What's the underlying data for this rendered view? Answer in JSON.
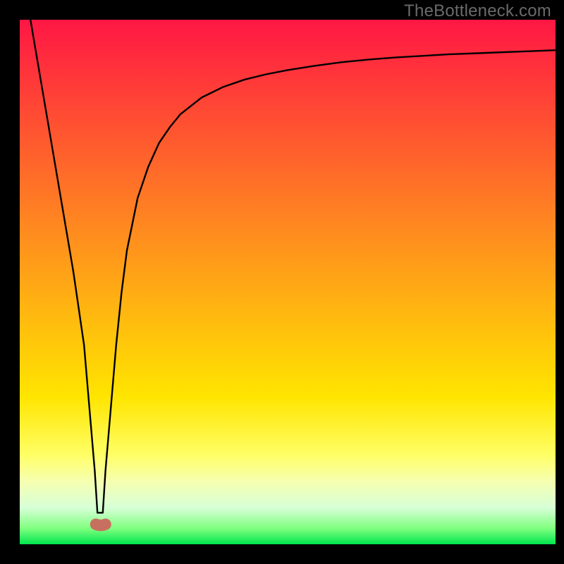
{
  "watermark": "TheBottleneck.com",
  "chart_data": {
    "type": "line",
    "title": "",
    "xlabel": "",
    "ylabel": "",
    "xlim": [
      0,
      100
    ],
    "ylim": [
      0,
      100
    ],
    "grid": false,
    "legend": false,
    "background_gradient": {
      "stops": [
        {
          "offset": 0.0,
          "color": "#ff1744"
        },
        {
          "offset": 0.4,
          "color": "#ff8a1f"
        },
        {
          "offset": 0.72,
          "color": "#ffe500"
        },
        {
          "offset": 0.83,
          "color": "#ffff66"
        },
        {
          "offset": 0.88,
          "color": "#f6ffb0"
        },
        {
          "offset": 0.93,
          "color": "#d7ffd7"
        },
        {
          "offset": 0.97,
          "color": "#7fff7f"
        },
        {
          "offset": 1.0,
          "color": "#00e64d"
        }
      ]
    },
    "series": [
      {
        "name": "bottleneck-curve",
        "color": "#000000",
        "x": [
          2,
          4,
          6,
          8,
          10,
          12,
          13,
          14,
          14.5,
          15.5,
          16,
          17,
          18,
          19,
          20,
          22,
          24,
          26,
          28,
          30,
          34,
          38,
          42,
          46,
          50,
          55,
          60,
          65,
          70,
          75,
          80,
          85,
          90,
          95,
          100
        ],
        "y": [
          100,
          88,
          76,
          64,
          52,
          38,
          26,
          14,
          6,
          6,
          14,
          26,
          38,
          48,
          56,
          66,
          72,
          76.5,
          79.5,
          82,
          85.2,
          87.2,
          88.6,
          89.6,
          90.4,
          91.2,
          91.9,
          92.4,
          92.8,
          93.1,
          93.4,
          93.6,
          93.8,
          94.0,
          94.2
        ]
      }
    ],
    "marker": {
      "name": "optimal-zone",
      "color": "#c77060",
      "cx1": 14.2,
      "cx2": 16.0,
      "cy": 3.8,
      "r": 1.1
    }
  }
}
